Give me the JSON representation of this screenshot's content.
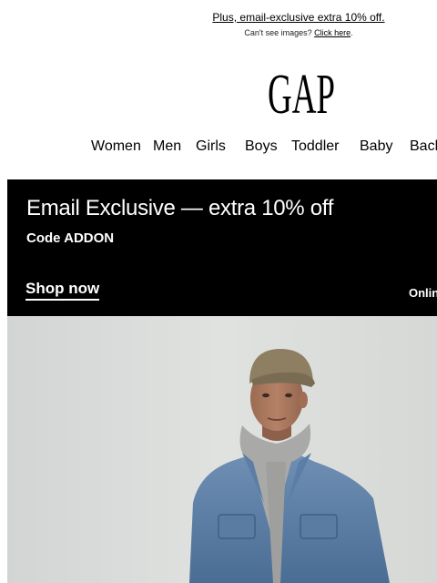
{
  "preheader": {
    "headline": "Plus, email-exclusive extra 10% off.",
    "images_prompt": "Can't see images?",
    "images_link": "Click here",
    "images_suffix": "."
  },
  "brand": {
    "logo_text": "GAP"
  },
  "nav": {
    "items": [
      "Women",
      "Men",
      "Girls",
      "Boys",
      "Toddler",
      "Baby",
      "Back"
    ]
  },
  "promo": {
    "title": "Email Exclusive — extra 10% off",
    "code": "Code ADDON",
    "cta": "Shop now",
    "note": "Onlin"
  },
  "hero": {
    "image": "model-in-denim-jacket-and-cap"
  },
  "colors": {
    "background": "#ffffff",
    "promo_bg": "#000000",
    "promo_text": "#ffffff",
    "hero_bg": "#d9dbd9",
    "denim": "#5b7fa6"
  }
}
